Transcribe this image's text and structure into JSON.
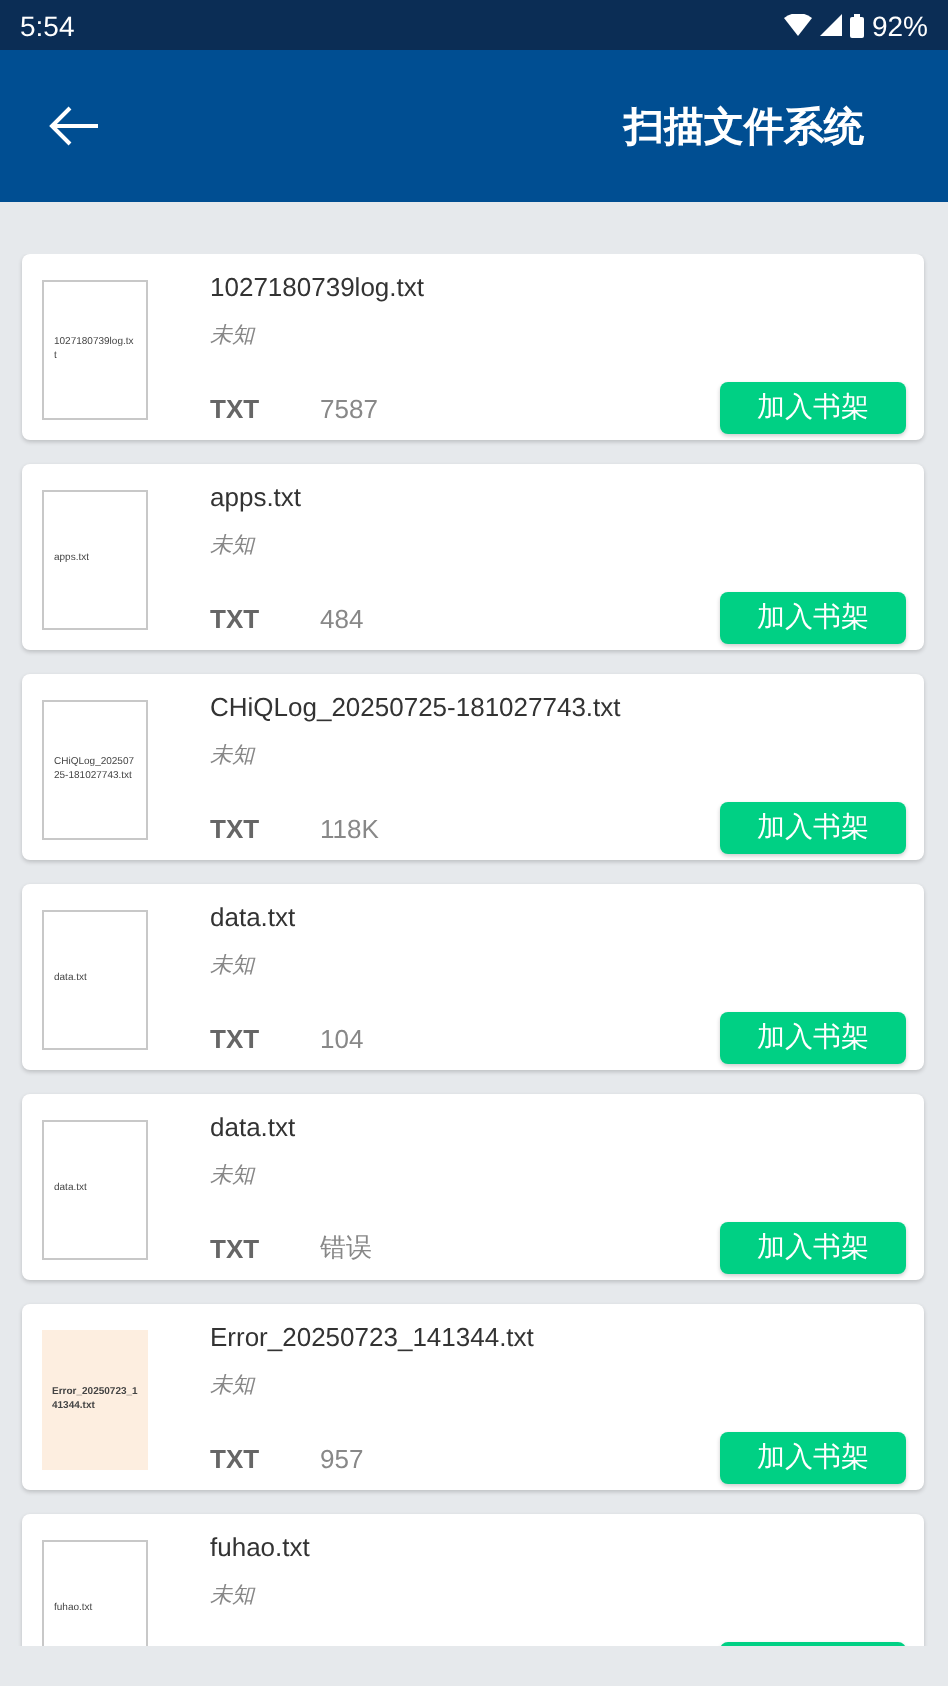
{
  "status_bar": {
    "time": "5:54",
    "battery": "92%"
  },
  "app_bar": {
    "title": "扫描文件系统"
  },
  "files": [
    {
      "name": "1027180739log.txt",
      "cover_text": "1027180739log.txt",
      "color": "#ffffff",
      "author": "未知",
      "type": "TXT",
      "size": "7587",
      "button": "加入书架"
    },
    {
      "name": "apps.txt",
      "cover_text": "apps.txt",
      "color": "#ffffff",
      "author": "未知",
      "type": "TXT",
      "size": "484",
      "button": "加入书架"
    },
    {
      "name": "CHiQLog_20250725-181027743.txt",
      "cover_text": "CHiQLog_20250725-181027743.txt",
      "color": "#ffffff",
      "author": "未知",
      "type": "TXT",
      "size": "118K",
      "button": "加入书架"
    },
    {
      "name": "data.txt",
      "cover_text": "data.txt",
      "color": "#ffffff",
      "author": "未知",
      "type": "TXT",
      "size": "104",
      "button": "加入书架"
    },
    {
      "name": "data.txt",
      "cover_text": "data.txt",
      "color": "#ffffff",
      "author": "未知",
      "type": "TXT",
      "size": "错误",
      "button": "加入书架"
    },
    {
      "name": "Error_20250723_141344.txt",
      "cover_text": "Error_20250723_141344.txt",
      "color": "#fdeee0",
      "author": "未知",
      "type": "TXT",
      "size": "957",
      "button": "加入书架"
    },
    {
      "name": "fuhao.txt",
      "cover_text": "fuhao.txt",
      "color": "#ffffff",
      "author": "未知"
    }
  ]
}
